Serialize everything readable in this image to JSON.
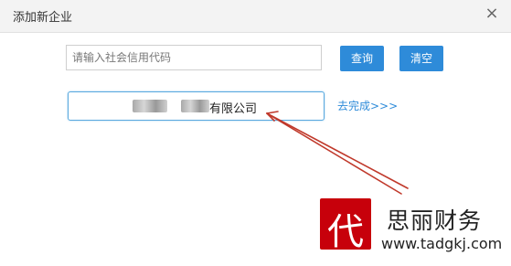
{
  "dialog": {
    "title": "添加新企业",
    "close_icon": "close-icon"
  },
  "search": {
    "placeholder": "请输入社会信用代码",
    "query_label": "查询",
    "clear_label": "清空"
  },
  "result": {
    "company_name_visible": "有限公司",
    "go_label": "去完成>>>"
  },
  "colors": {
    "primary": "#2e8bd9",
    "arrow": "#c0392b",
    "stamp": "#c7000b"
  },
  "watermark": {
    "stamp_char": "代",
    "brand": "思丽财务",
    "url": "www.tadgkj.com"
  }
}
